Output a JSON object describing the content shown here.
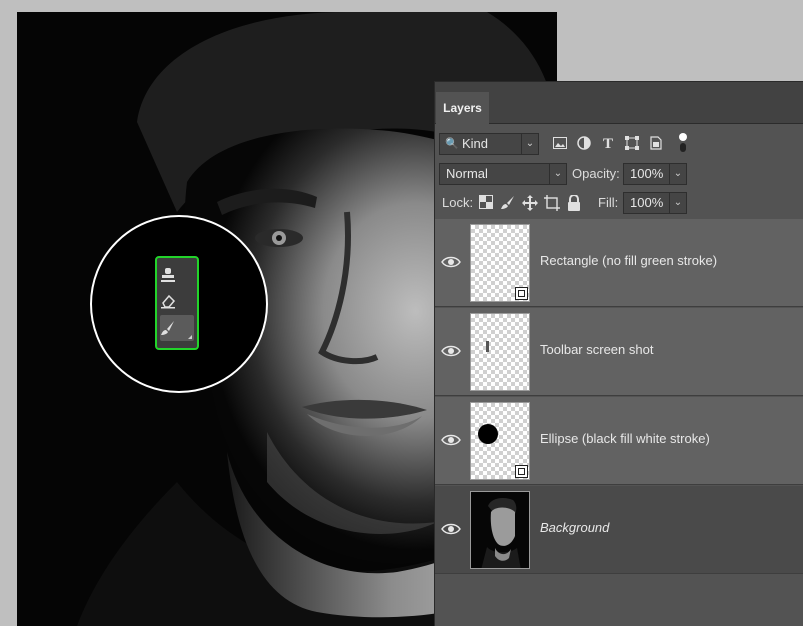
{
  "colors": {
    "panel_bg": "#535353",
    "highlight_stroke": "#22d42a",
    "callout_stroke": "#ffffff"
  },
  "callout": {
    "tools": [
      {
        "name": "clone-stamp-icon",
        "glyph": "♟"
      },
      {
        "name": "eraser-icon",
        "glyph": "⌫"
      },
      {
        "name": "brush-icon",
        "glyph": "🖌"
      }
    ]
  },
  "layers_panel": {
    "tab_label": "Layers",
    "filter": {
      "kind_value": "Kind",
      "filter_icons": [
        "image-filter-icon",
        "adjustment-filter-icon",
        "type-filter-icon",
        "shape-filter-icon",
        "smart-object-filter-icon"
      ]
    },
    "blend_mode": "Normal",
    "opacity_label": "Opacity:",
    "opacity_value": "100%",
    "lock_label": "Lock:",
    "fill_label": "Fill:",
    "fill_value": "100%",
    "layers": [
      {
        "name": "Rectangle (no fill green stroke)",
        "type": "shape"
      },
      {
        "name": "Toolbar screen shot",
        "type": "pixel"
      },
      {
        "name": "Ellipse (black fill white stroke)",
        "type": "shape"
      },
      {
        "name": "Background",
        "type": "background"
      }
    ]
  }
}
